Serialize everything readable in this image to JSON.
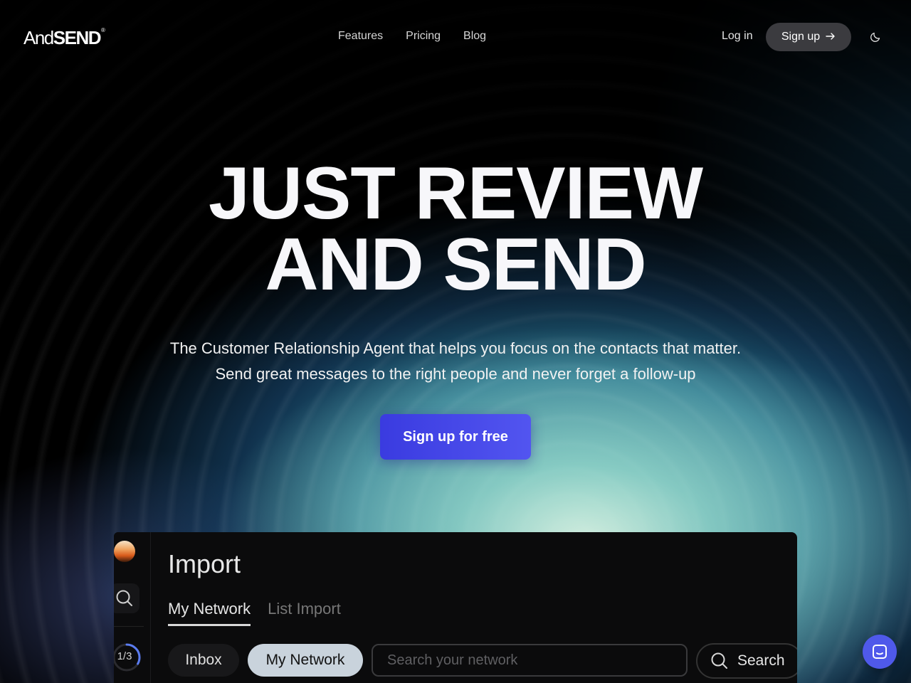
{
  "brand": {
    "logo_light": "And",
    "logo_bold": "SEND",
    "logo_mark": "®"
  },
  "nav": {
    "items": [
      "Features",
      "Pricing",
      "Blog"
    ],
    "login": "Log in",
    "signup": "Sign up",
    "signup_icon": "arrow-right-icon",
    "theme_icon": "moon-icon"
  },
  "hero": {
    "headline_line1": "JUST REVIEW",
    "headline_line2": "AND SEND",
    "sub_line1": "The Customer Relationship Agent that helps you focus on the contacts that matter.",
    "sub_line2": "Send great messages to the right people and never forget a follow-up",
    "cta": "Sign up for free",
    "cta_color": "#3a3be0"
  },
  "app_preview": {
    "title": "Import",
    "tabs": [
      {
        "label": "My Network",
        "active": true
      },
      {
        "label": "List Import",
        "active": false
      }
    ],
    "progress_label": "1/3",
    "progress_fraction": 0.333,
    "filters": {
      "inbox": "Inbox",
      "network": "My Network"
    },
    "search_placeholder": "Search your network",
    "search_button": "Search"
  },
  "chat_icon": "chat-icon"
}
